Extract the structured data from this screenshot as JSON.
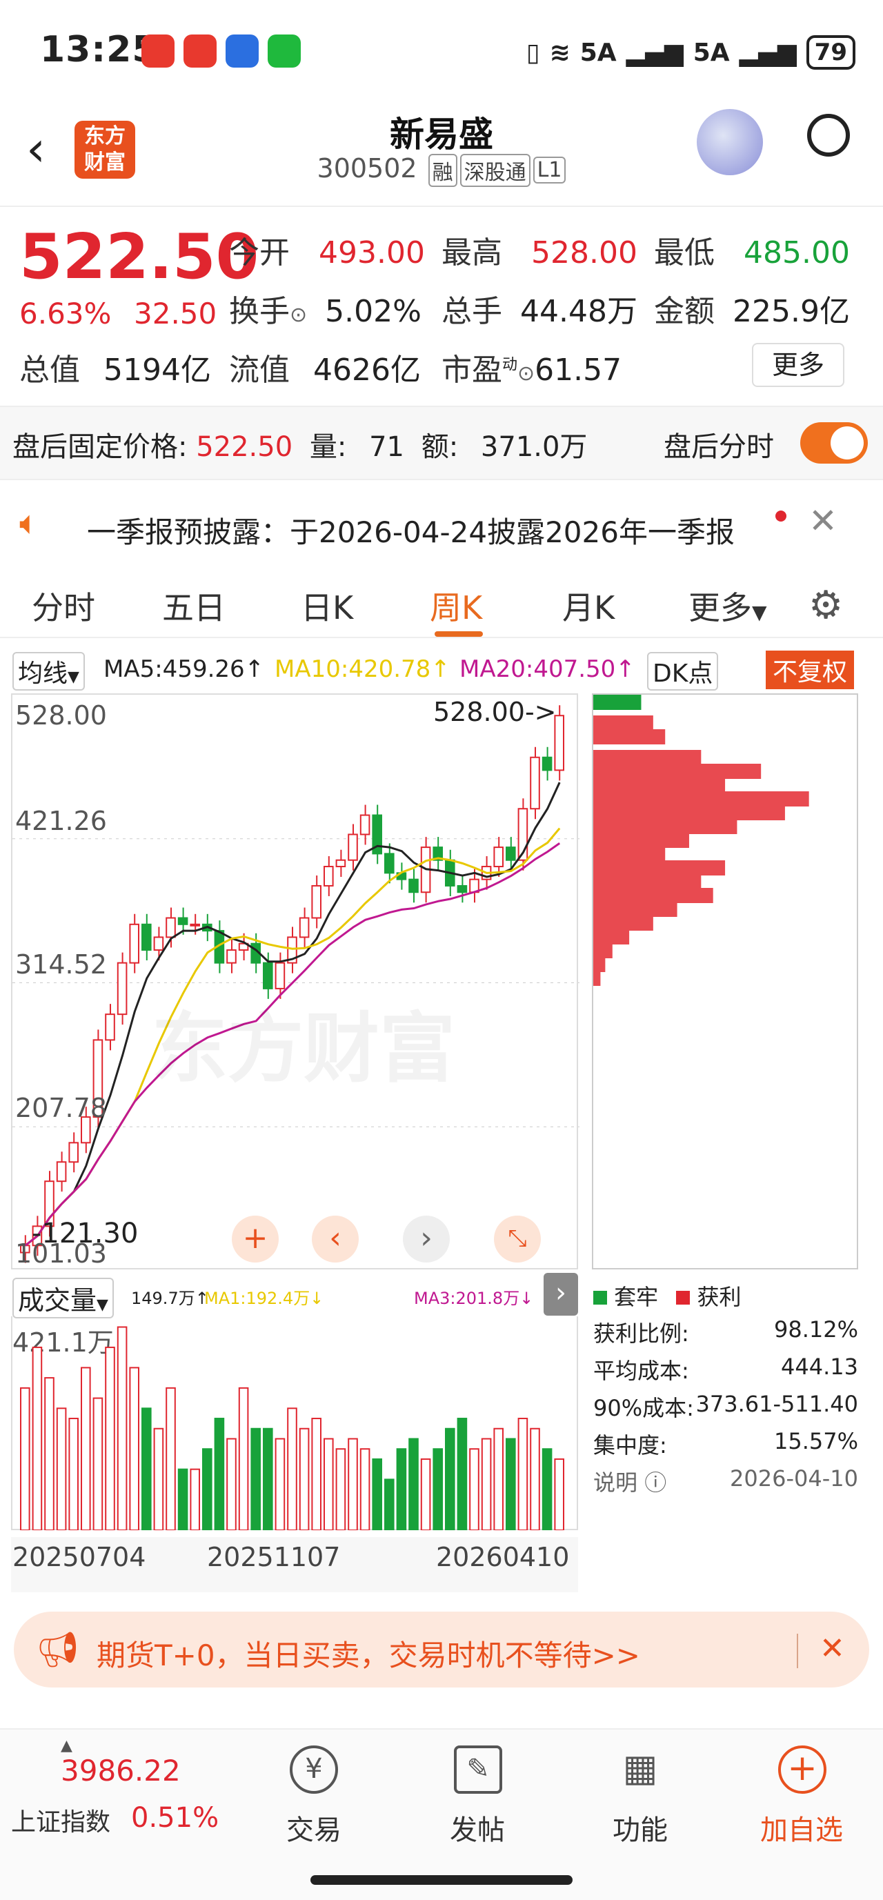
{
  "status_bar": {
    "time": "13:25",
    "battery": "79",
    "signal1": "5A",
    "signal2": "5A"
  },
  "header": {
    "title": "新易盛",
    "code": "300502",
    "tags": [
      "融",
      "深股通",
      "L1"
    ],
    "brand_line1": "东方",
    "brand_line2": "财富"
  },
  "quote": {
    "price": "522.50",
    "change_pct": "6.63%",
    "change": "32.50",
    "open_label": "今开",
    "open": "493.00",
    "high_label": "最高",
    "high": "528.00",
    "low_label": "最低",
    "low": "485.00",
    "turnover_label": "换手",
    "turnover": "5.02%",
    "volume_label": "总手",
    "volume": "44.48万",
    "amount_label": "金额",
    "amount": "225.9亿",
    "mcap_label": "总值",
    "mcap": "5194亿",
    "float_label": "流值",
    "float": "4626亿",
    "pe_label": "市盈",
    "pe_sup": "动",
    "pe": "61.57",
    "more_label": "更多"
  },
  "after_hours": {
    "label": "盘后固定价格:",
    "price": "522.50",
    "vol_label": "量:",
    "vol": "71",
    "amt_label": "额:",
    "amt": "371.0万",
    "toggle_label": "盘后分时"
  },
  "notice": {
    "text": "一季报预披露：于2026-04-24披露2026年一季报"
  },
  "tabs": [
    "分时",
    "五日",
    "日K",
    "周K",
    "月K",
    "更多"
  ],
  "active_tab": "周K",
  "ma_bar": {
    "selector": "均线",
    "ma5": "MA5:459.26↑",
    "ma10": "MA10:420.78↑",
    "ma20": "MA20:407.50↑",
    "dk": "DK点",
    "adjust": "不复权",
    "color_ma5": "#222222",
    "color_ma10": "#e8c800",
    "color_ma20": "#c01890"
  },
  "price_axis": [
    "528.00",
    "421.26",
    "314.52",
    "207.78",
    "101.03"
  ],
  "chart_annotations": {
    "high_marker": "528.00->",
    "low_marker": "-121.30",
    "watermark": "东方财富"
  },
  "volume_bar": {
    "selector": "成交量",
    "v": "149.7万↑",
    "ma1": "MA1:192.4万↓",
    "ma3": "MA3:201.8万↓",
    "axis_top": "421.1万"
  },
  "date_axis": [
    "20250704",
    "20251107",
    "20260410"
  ],
  "chip": {
    "legend_trapped": "套牢",
    "legend_profit": "获利",
    "rows": [
      {
        "label": "获利比例:",
        "value": "98.12%"
      },
      {
        "label": "平均成本:",
        "value": "444.13"
      },
      {
        "label": "90%成本:",
        "value": "373.61-511.40"
      },
      {
        "label": "集中度:",
        "value": "15.57%"
      },
      {
        "label": "说明",
        "value": "2026-04-10"
      }
    ]
  },
  "ad_banner": {
    "text": "期货T+0，当日买卖，交易时机不等待>>"
  },
  "bottom_nav": {
    "index_value": "3986.22",
    "index_name": "上证指数",
    "index_change": "0.51%",
    "items": [
      "交易",
      "发帖",
      "功能",
      "加自选"
    ]
  },
  "colors": {
    "up": "#e0262f",
    "down": "#18a23a",
    "accent": "#f0701e"
  },
  "chart_data": {
    "type": "candlestick",
    "price_ylim": [
      101.03,
      528.0
    ],
    "candles_close_approx": [
      110,
      125,
      160,
      175,
      190,
      210,
      270,
      290,
      330,
      360,
      340,
      350,
      365,
      360,
      360,
      355,
      330,
      340,
      345,
      330,
      310,
      330,
      350,
      365,
      390,
      405,
      410,
      430,
      445,
      415,
      400,
      395,
      385,
      420,
      410,
      390,
      385,
      395,
      405,
      420,
      410,
      450,
      490,
      480,
      522.5
    ]
  }
}
